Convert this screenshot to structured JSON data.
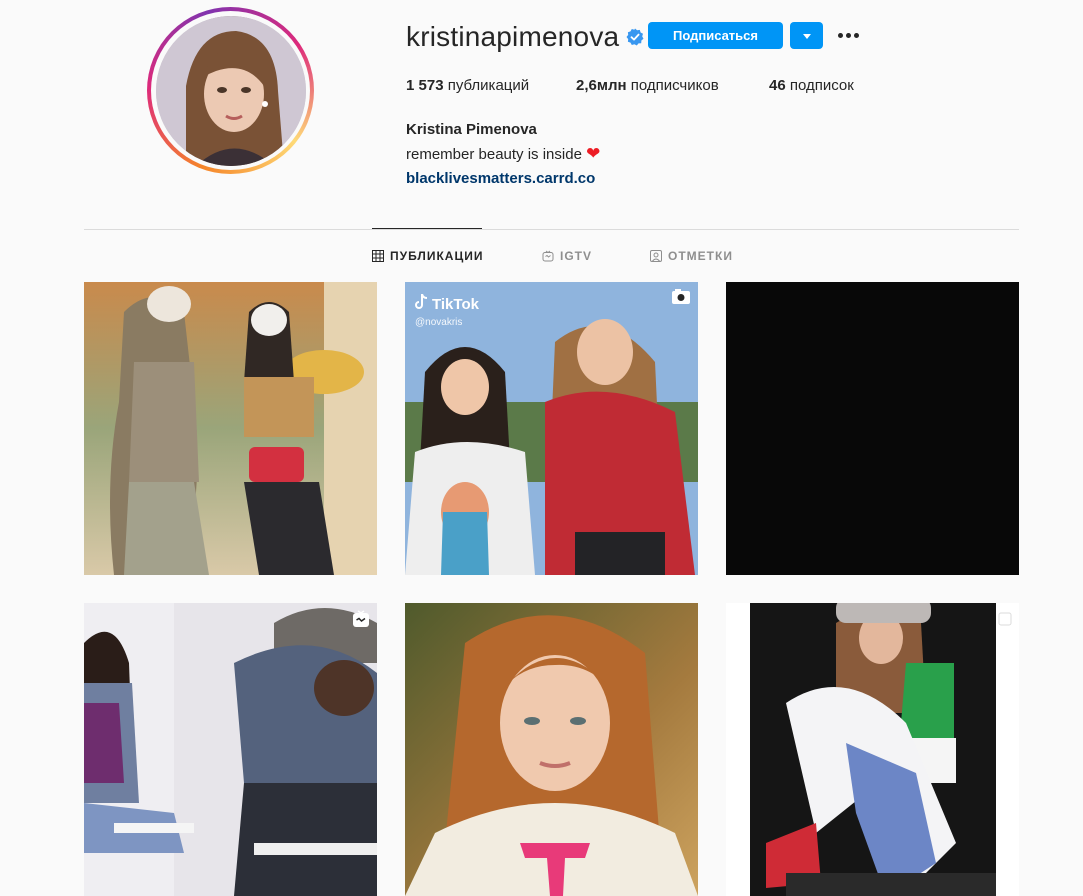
{
  "profile": {
    "username": "kristinapimenova",
    "verified": true,
    "follow_label": "Подписаться",
    "stats": {
      "posts_count": "1 573",
      "posts_label": " публикаций",
      "followers_count": "2,6млн",
      "followers_label": " подписчиков",
      "following_count": "46",
      "following_label": " подписок"
    },
    "full_name": "Kristina Pimenova",
    "bio": "remember beauty is inside",
    "bio_emoji": "❤",
    "website": "blacklivesmatters.carrd.co"
  },
  "tabs": [
    {
      "label": "ПУБЛИКАЦИИ",
      "icon": "grid-icon",
      "active": true
    },
    {
      "label": "IGTV",
      "icon": "igtv-icon",
      "active": false
    },
    {
      "label": "ОТМЕТКИ",
      "icon": "tagged-icon",
      "active": false
    }
  ],
  "posts": [
    {
      "type": "photo",
      "description_icon": "none"
    },
    {
      "type": "video",
      "overlay_text": "TikTok",
      "overlay_handle": "@novakris",
      "badge": "video-icon"
    },
    {
      "type": "photo",
      "badge": "none"
    },
    {
      "type": "igtv",
      "badge": "igtv-icon"
    },
    {
      "type": "photo",
      "badge": "none"
    },
    {
      "type": "carousel",
      "badge": "carousel-icon"
    }
  ],
  "colors": {
    "accent": "#0095f6",
    "link": "#00376b",
    "verified": "#3897f0",
    "heart": "#ed1c24"
  }
}
